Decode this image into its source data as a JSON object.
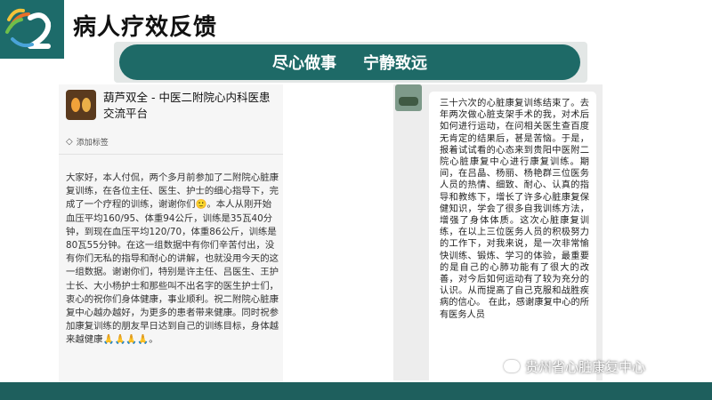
{
  "header": {
    "title": "病人疗效反馈"
  },
  "banner": {
    "slogan_left": "尽心做事",
    "slogan_right": "宁静致远"
  },
  "left_post": {
    "group_name": "葫芦双全 - 中医二附院心内科医患交流平台",
    "tag_label": "添加标签",
    "body": "大家好，本人付侃，两个多月前参加了二附院心脏康复训练，在各位主任、医生、护士的细心指导下，完成了一个疗程的训练，谢谢你们🙂。本人从刚开始血压平均160/95、体重94公斤，训练是35瓦40分钟，到现在血压平均120/70，体重86公斤，训练是80瓦55分钟。在这一组数据中有你们辛苦付出，没有你们无私的指导和耐心的讲解，也就没用今天的这一组数据。谢谢你们，特别是许主任、吕医生、王护士长、大小杨护士和那些叫不出名字的医生护士们，衷心的祝你们身体健康，事业顺利。祝二附院心脏康复中心越办越好，为更多的患者带来健康。同时祝参加康复训练的朋友早日达到自己的训练目标，身体越来越健康🙏🙏🙏🙏。"
  },
  "right_chat": {
    "message": "三十六次的心脏康复训练结束了。去年两次做心脏支架手术的我，对术后如何进行运动，在问相关医生查百度无肯定的结果后，甚是苦恼。于是，报着试试看的心态来到贵阳中医附二院心脏康复中心进行康复训练。期间，在吕晶、杨丽、杨艳群三位医务人员的热情、细致、耐心、认真的指导和教练下，增长了许多心脏康复保健知识，学会了很多自我训练方法，增强了身体体质。这次心脏康复训练，在以上三位医务人员的积极努力的工作下，对我来说，是一次非常愉快训练、锻炼、学习的体验，最重要的是自己的心肺功能有了很大的改善，对今后如何运动有了较为充分的认识。从而提高了自己克服和战胜疾病的信心。    在此，感谢康复中心的所有医务人员"
  },
  "watermark": {
    "text": "贵州省心脏康复中心"
  },
  "colors": {
    "teal": "#1e6a67",
    "banner_bg": "#e3e7e6",
    "bottom_bar": "#1e5f5d"
  }
}
